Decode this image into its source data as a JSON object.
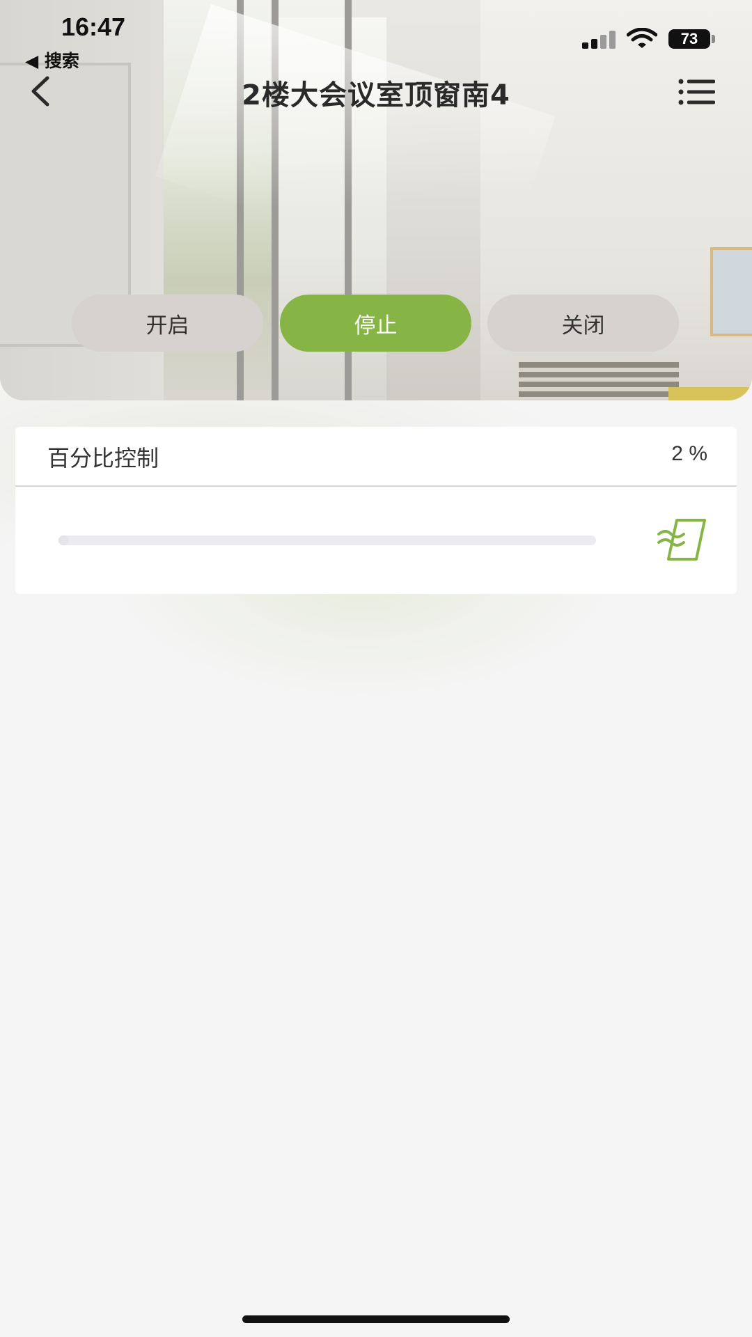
{
  "status_bar": {
    "time": "16:47",
    "back_app": "◀ 搜索",
    "battery": "73"
  },
  "nav": {
    "title": "2楼大会议室顶窗南4",
    "back_icon": "chevron-left-icon",
    "menu_icon": "list-menu-icon"
  },
  "controls": {
    "open_label": "开启",
    "stop_label": "停止",
    "close_label": "关闭",
    "active": "stop",
    "accent_color": "#86b545"
  },
  "percent_card": {
    "label": "百分比控制",
    "value_text": "2 %",
    "value_percent": 2,
    "icon": "window-open-icon"
  }
}
